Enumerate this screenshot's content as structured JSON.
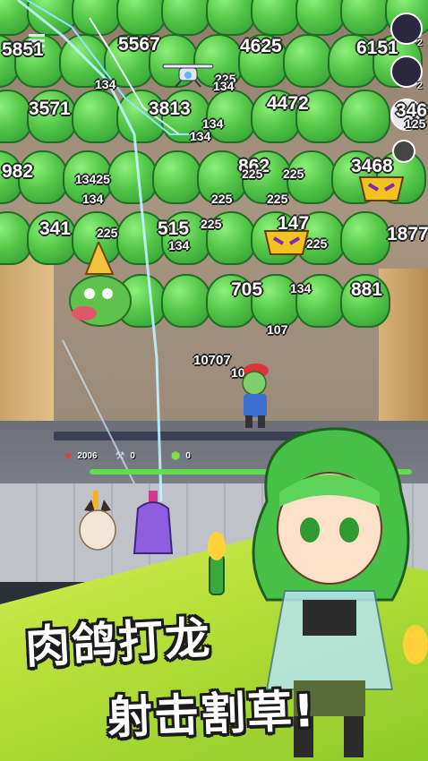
{
  "title": {
    "line1": "肉鸽打龙",
    "line2": "射击割草!"
  },
  "hud": {
    "hp_value": "2006",
    "shield_value": "0",
    "gem_value": "0"
  },
  "right_avatars": [
    {
      "badge": "2"
    },
    {
      "badge": "2"
    },
    {
      "badge": ""
    }
  ],
  "big_numbers": [
    {
      "text": "5851"
    },
    {
      "text": "5567"
    },
    {
      "text": "4625"
    },
    {
      "text": "6151"
    },
    {
      "text": "3571"
    },
    {
      "text": "3813"
    },
    {
      "text": "4472"
    },
    {
      "text": "346"
    },
    {
      "text": "982"
    },
    {
      "text": "862"
    },
    {
      "text": "3468"
    },
    {
      "text": "341"
    },
    {
      "text": "515"
    },
    {
      "text": "147"
    },
    {
      "text": "1877"
    },
    {
      "text": "705"
    },
    {
      "text": "881"
    },
    {
      "text": "10707"
    }
  ],
  "small_numbers": [
    {
      "text": "225"
    },
    {
      "text": "134"
    },
    {
      "text": "134"
    },
    {
      "text": "134"
    },
    {
      "text": "134"
    },
    {
      "text": "125"
    },
    {
      "text": "13425"
    },
    {
      "text": "225"
    },
    {
      "text": "225"
    },
    {
      "text": "134"
    },
    {
      "text": "225"
    },
    {
      "text": "225"
    },
    {
      "text": "225"
    },
    {
      "text": "225"
    },
    {
      "text": "134"
    },
    {
      "text": "225"
    },
    {
      "text": "134"
    },
    {
      "text": "107"
    },
    {
      "text": "107"
    }
  ],
  "colors": {
    "slime": "#55c84a",
    "title_text": "#ffffff",
    "title_outline": "#1b1b1b",
    "hp_bar": "#5fe04a",
    "background_bottom": "#b9e03a"
  }
}
